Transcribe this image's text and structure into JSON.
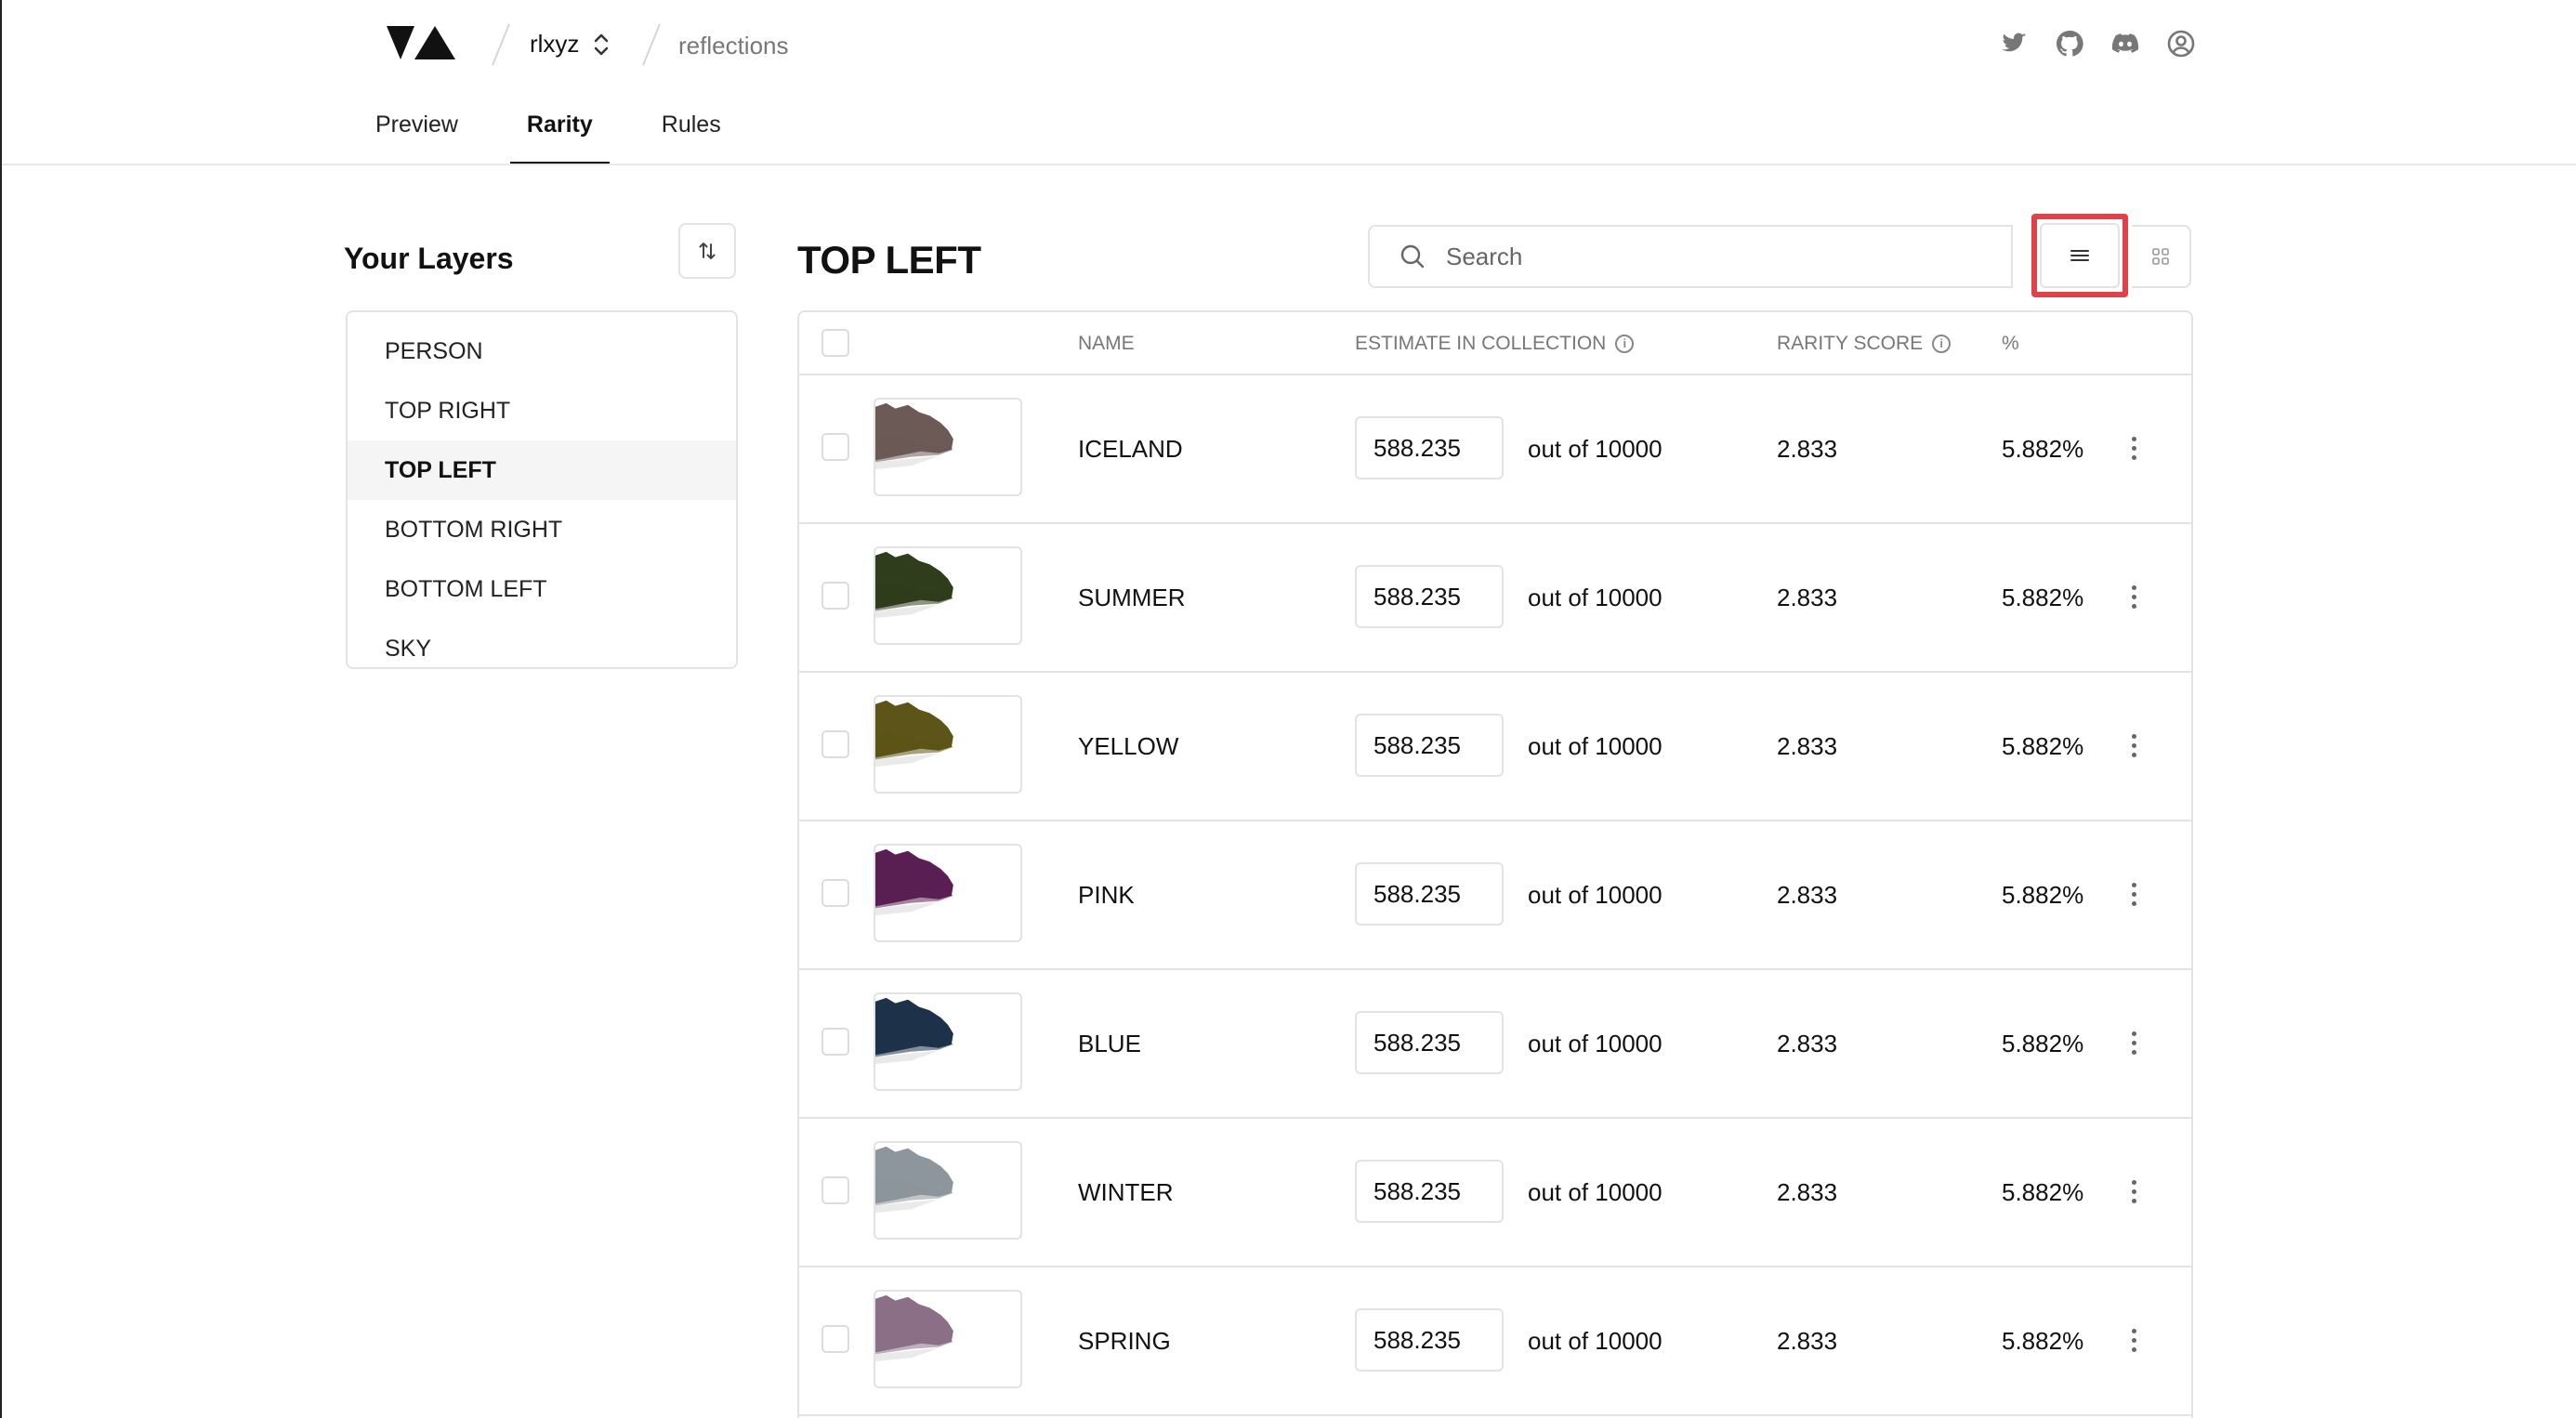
{
  "header": {
    "project": "rlxyz",
    "collection": "reflections",
    "tabs": [
      {
        "label": "Preview"
      },
      {
        "label": "Rarity"
      },
      {
        "label": "Rules"
      }
    ]
  },
  "sidebar": {
    "title": "Your Layers",
    "items": [
      {
        "label": "PERSON"
      },
      {
        "label": "TOP RIGHT"
      },
      {
        "label": "TOP LEFT"
      },
      {
        "label": "BOTTOM RIGHT"
      },
      {
        "label": "BOTTOM LEFT"
      },
      {
        "label": "SKY"
      }
    ]
  },
  "main": {
    "title": "TOP LEFT",
    "search_placeholder": "Search",
    "columns": {
      "name": "NAME",
      "estimate": "ESTIMATE IN COLLECTION",
      "score": "RARITY SCORE",
      "pct": "%"
    },
    "rows": [
      {
        "name": "ICELAND",
        "estimate": "588.235",
        "out_of": "out of 10000",
        "score": "2.833",
        "pct": "5.882%",
        "color": "#6b5a55"
      },
      {
        "name": "SUMMER",
        "estimate": "588.235",
        "out_of": "out of 10000",
        "score": "2.833",
        "pct": "5.882%",
        "color": "#2f3d1c"
      },
      {
        "name": "YELLOW",
        "estimate": "588.235",
        "out_of": "out of 10000",
        "score": "2.833",
        "pct": "5.882%",
        "color": "#5c5418"
      },
      {
        "name": "PINK",
        "estimate": "588.235",
        "out_of": "out of 10000",
        "score": "2.833",
        "pct": "5.882%",
        "color": "#5a1f52"
      },
      {
        "name": "BLUE",
        "estimate": "588.235",
        "out_of": "out of 10000",
        "score": "2.833",
        "pct": "5.882%",
        "color": "#1d3148"
      },
      {
        "name": "WINTER",
        "estimate": "588.235",
        "out_of": "out of 10000",
        "score": "2.833",
        "pct": "5.882%",
        "color": "#8d969c"
      },
      {
        "name": "SPRING",
        "estimate": "588.235",
        "out_of": "out of 10000",
        "score": "2.833",
        "pct": "5.882%",
        "color": "#8a6f86"
      }
    ]
  },
  "colors": {
    "highlight": "#e0424a"
  }
}
